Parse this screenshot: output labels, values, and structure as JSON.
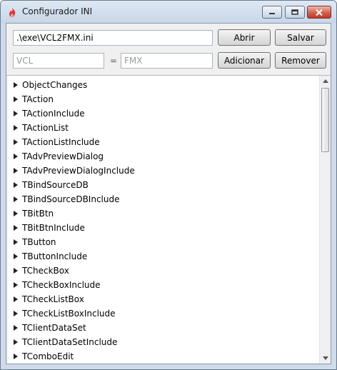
{
  "window": {
    "title": "Configurador INI",
    "icon": "flame-icon"
  },
  "file_row": {
    "path_value": ".\\exe\\VCL2FMX.ini",
    "open_label": "Abrir",
    "save_label": "Salvar"
  },
  "mapping_row": {
    "vcl_placeholder": "VCL",
    "equals": "=",
    "fmx_placeholder": "FMX",
    "add_label": "Adicionar",
    "remove_label": "Remover"
  },
  "tree": {
    "items": [
      "ObjectChanges",
      "TAction",
      "TActionInclude",
      "TActionList",
      "TActionListInclude",
      "TAdvPreviewDialog",
      "TAdvPreviewDialogInclude",
      "TBindSourceDB",
      "TBindSourceDBInclude",
      "TBitBtn",
      "TBitBtnInclude",
      "TButton",
      "TButtonInclude",
      "TCheckBox",
      "TCheckBoxInclude",
      "TCheckListBox",
      "TCheckListBoxInclude",
      "TClientDataSet",
      "TClientDataSetInclude",
      "TComboEdit"
    ]
  },
  "colors": {
    "accent": "#3c7fb1",
    "close_button": "#c0392b"
  }
}
